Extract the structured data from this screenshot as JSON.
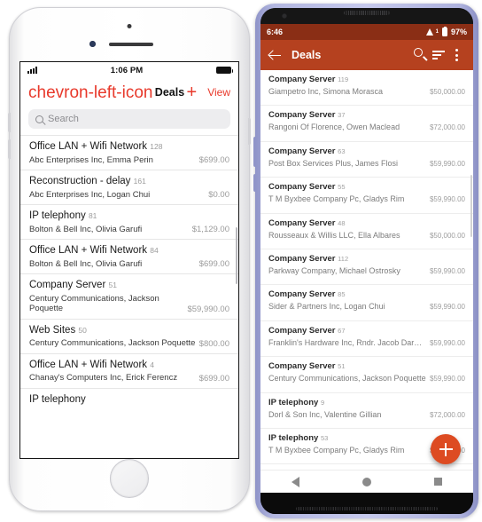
{
  "colors": {
    "ios_accent": "#e8392b",
    "android_appbar": "#b5411f",
    "android_statusbar": "#8a2e15",
    "android_fab": "#dd4b22"
  },
  "iphone": {
    "status": {
      "time": "1:06 PM",
      "signal_icon": "signal-bars-icon",
      "battery_icon": "battery-full-icon"
    },
    "navbar": {
      "back_icon": "chevron-left-icon",
      "title": "Deals",
      "add_label": "+",
      "view_label": "View"
    },
    "search": {
      "icon": "search-icon",
      "placeholder": "Search"
    },
    "list": [
      {
        "title": "Office LAN + Wifi Network",
        "number": "128",
        "subtitle": "Abc Enterprises Inc, Emma Perin",
        "amount": "$699.00"
      },
      {
        "title": "Reconstruction - delay",
        "number": "161",
        "subtitle": "Abc Enterprises Inc, Logan Chui",
        "amount": "$0.00"
      },
      {
        "title": "IP telephony",
        "number": "81",
        "subtitle": "Bolton & Bell Inc, Olivia Garufi",
        "amount": "$1,129.00"
      },
      {
        "title": "Office LAN + Wifi Network",
        "number": "84",
        "subtitle": "Bolton & Bell Inc, Olivia Garufi",
        "amount": "$699.00"
      },
      {
        "title": "Company Server",
        "number": "51",
        "subtitle": "Century Communications, Jackson Poquette",
        "amount": "$59,990.00"
      },
      {
        "title": "Web Sites",
        "number": "50",
        "subtitle": "Century Communications, Jackson Poquette",
        "amount": "$800.00"
      },
      {
        "title": "Office LAN + Wifi Network",
        "number": "4",
        "subtitle": "Chanay's Computers Inc, Erick Ferencz",
        "amount": "$699.00"
      },
      {
        "title": "IP telephony",
        "number": "",
        "subtitle": "",
        "amount": ""
      }
    ]
  },
  "android": {
    "status": {
      "time": "6:46",
      "wifi_icon": "wifi-icon",
      "wifi_sup": "1",
      "battery_icon": "battery-icon",
      "battery_level": "97%"
    },
    "appbar": {
      "back_icon": "arrow-back-icon",
      "title": "Deals",
      "search_icon": "search-icon",
      "sort_icon": "sort-icon",
      "more_icon": "overflow-menu-icon"
    },
    "fab": {
      "icon": "plus-icon"
    },
    "navbar": {
      "back_icon": "nav-back-icon",
      "home_icon": "nav-home-icon",
      "recents_icon": "nav-recents-icon"
    },
    "list": [
      {
        "title": "Company Server",
        "number": "119",
        "subtitle": "Giampetro Inc, Simona Morasca",
        "amount": "$50,000.00"
      },
      {
        "title": "Company Server",
        "number": "37",
        "subtitle": "Rangoni Of Florence, Owen Maclead",
        "amount": "$72,000.00"
      },
      {
        "title": "Company Server",
        "number": "63",
        "subtitle": "Post Box Services Plus, James Flosi",
        "amount": "$59,990.00"
      },
      {
        "title": "Company Server",
        "number": "55",
        "subtitle": "T M Byxbee Company Pc, Gladys Rim",
        "amount": "$59,990.00"
      },
      {
        "title": "Company Server",
        "number": "48",
        "subtitle": "Rousseaux & Willis LLC, Ella Albares",
        "amount": "$50,000.00"
      },
      {
        "title": "Company Server",
        "number": "112",
        "subtitle": "Parkway Company, Michael Ostrosky",
        "amount": "$59,990.00"
      },
      {
        "title": "Company Server",
        "number": "85",
        "subtitle": "Sider & Partners Inc, Logan Chui",
        "amount": "$59,990.00"
      },
      {
        "title": "Company Server",
        "number": "67",
        "subtitle": "Franklin's Hardware Inc, Rndr. Jacob Darakjy",
        "amount": "$59,990.00"
      },
      {
        "title": "Company Server",
        "number": "51",
        "subtitle": "Century Communications, Jackson Poquette",
        "amount": "$59,990.00"
      },
      {
        "title": "IP telephony",
        "number": "9",
        "subtitle": "Dorl & Son Inc, Valentine Gillian",
        "amount": "$72,000.00"
      },
      {
        "title": "IP telephony",
        "number": "53",
        "subtitle": "T M Byxbee Company Pc, Gladys Rim",
        "amount": "$59,990.00"
      }
    ]
  }
}
